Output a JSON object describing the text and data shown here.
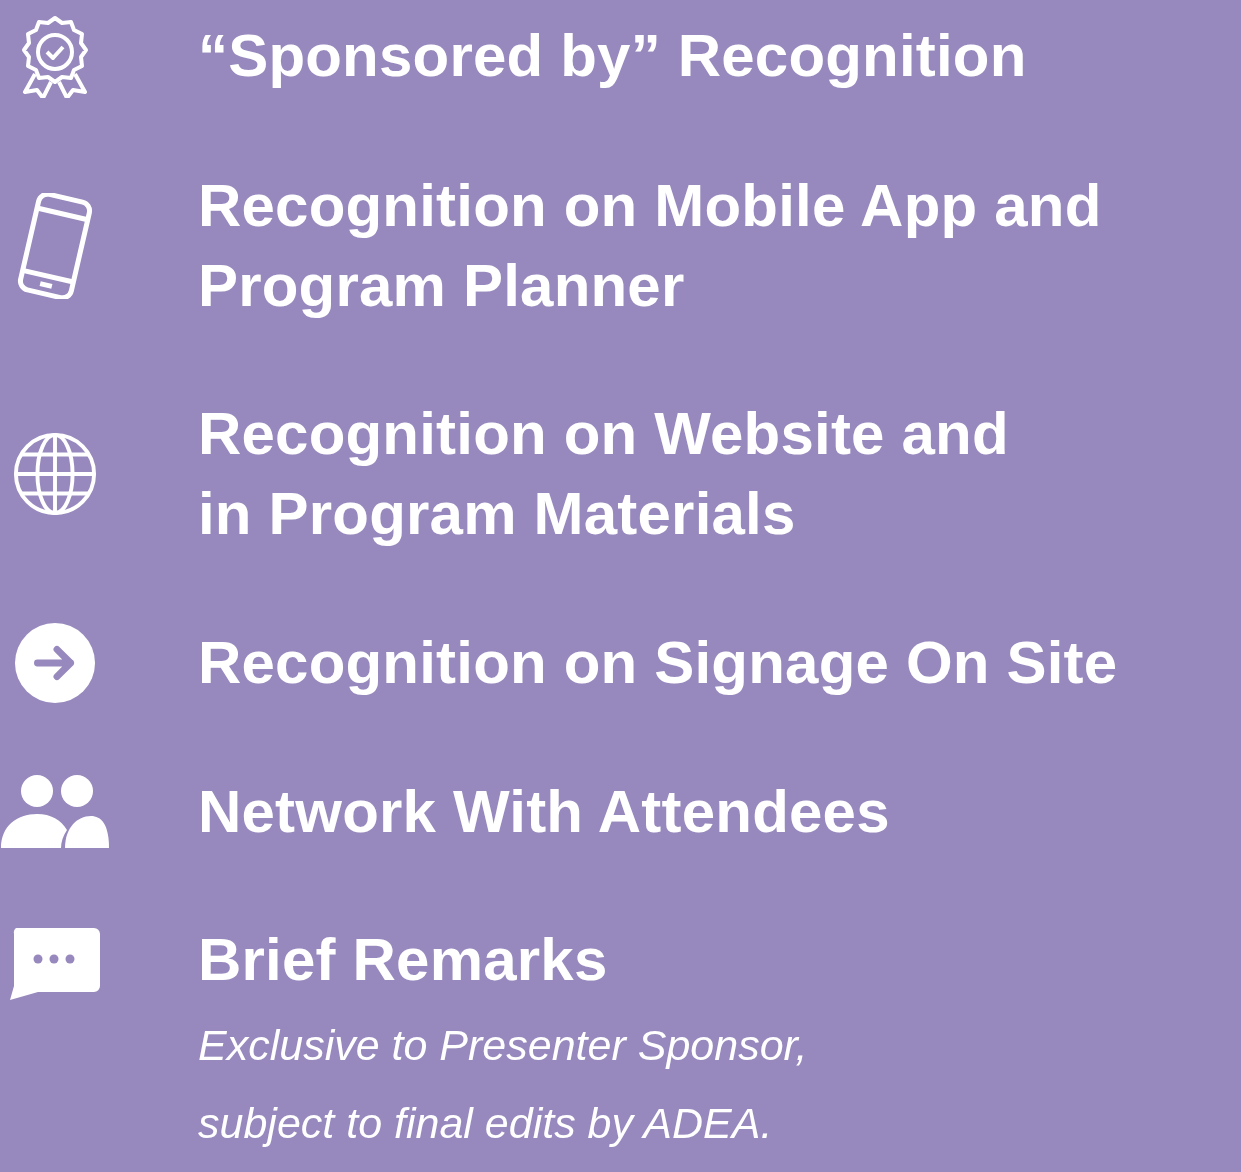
{
  "benefits": [
    {
      "kind": "award",
      "title": "“Sponsored by” Recognition"
    },
    {
      "kind": "phone",
      "title": "Recognition on Mobile App and\nProgram Planner"
    },
    {
      "kind": "globe",
      "title": "Recognition on Website and\nin Program Materials"
    },
    {
      "kind": "arrow",
      "title": "Recognition on Signage On Site"
    },
    {
      "kind": "people",
      "title": "Network With Attendees"
    },
    {
      "kind": "chat",
      "title": "Brief Remarks",
      "note": "Exclusive to Presenter Sponsor,\nsubject to final edits by ADEA."
    }
  ]
}
